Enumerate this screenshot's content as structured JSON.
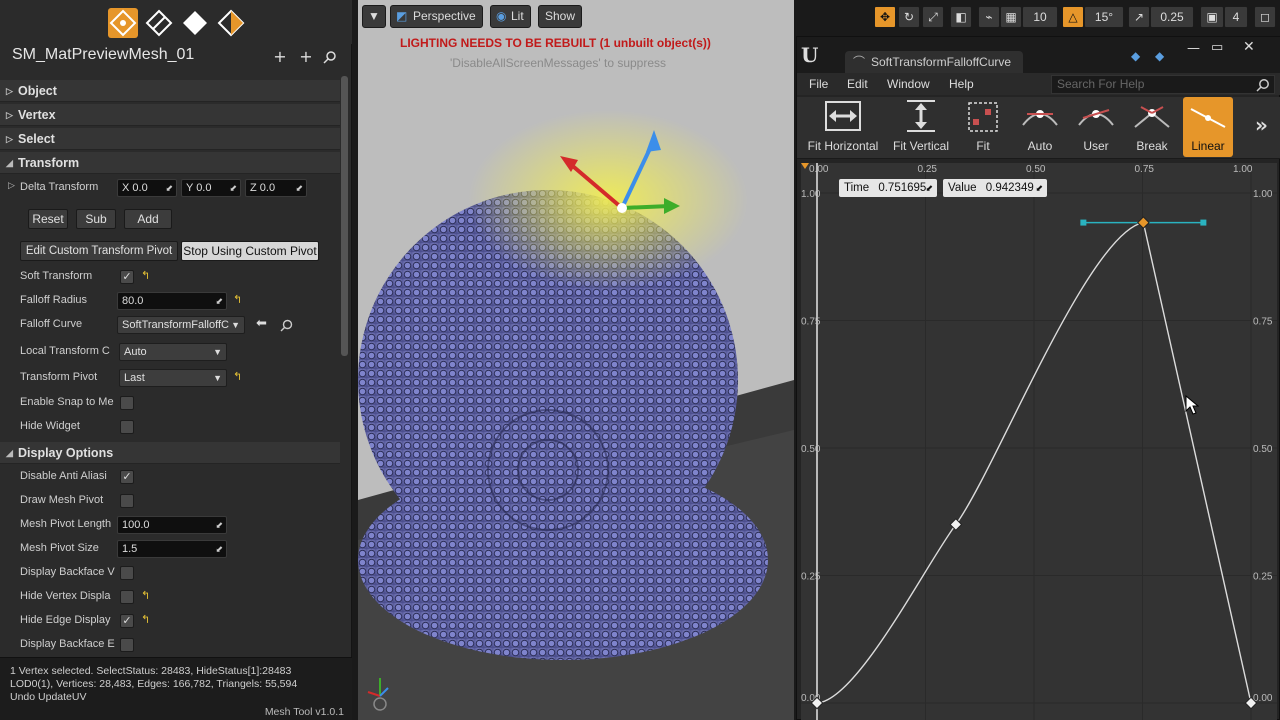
{
  "left_panel": {
    "mesh_name": "SM_MatPreviewMesh_01",
    "categories": {
      "object": "Object",
      "vertex": "Vertex",
      "select": "Select",
      "transform": "Transform",
      "display_options": "Display Options"
    },
    "delta_transform": {
      "label": "Delta Transform",
      "x": "X  0.0",
      "y": "Y  0.0",
      "z": "Z  0.0"
    },
    "buttons": {
      "reset": "Reset",
      "sub": "Sub",
      "add": "Add",
      "edit_pivot": "Edit Custom Transform Pivot",
      "stop_pivot": "Stop Using Custom Pivot"
    },
    "transform_rows": {
      "soft_transform": "Soft Transform",
      "soft_transform_checked": true,
      "falloff_radius": "Falloff Radius",
      "falloff_radius_value": "80.0",
      "falloff_curve": "Falloff Curve",
      "falloff_curve_value": "SoftTransformFalloffC",
      "local_transform": "Local Transform C",
      "local_transform_value": "Auto",
      "transform_pivot": "Transform Pivot",
      "transform_pivot_value": "Last",
      "enable_snap": "Enable Snap to Me",
      "hide_widget": "Hide Widget"
    },
    "display_rows": {
      "disable_aa": "Disable Anti Aliasi",
      "draw_mesh_pivot": "Draw Mesh Pivot",
      "mesh_pivot_length": "Mesh Pivot Length",
      "mesh_pivot_length_value": "100.0",
      "mesh_pivot_size": "Mesh Pivot Size",
      "mesh_pivot_size_value": "1.5",
      "display_backface": "Display Backface V",
      "hide_vertex": "Hide Vertex Displa",
      "hide_edge": "Hide Edge Display",
      "display_backface_e": "Display Backface E"
    },
    "status": {
      "line1": "1 Vertex selected. SelectStatus: 28483, HideStatus[1]:28483",
      "line2": "LOD0(1), Vertices: 28,483, Edges: 166,782, Triangels: 55,594",
      "line3": "Undo UpdateUV",
      "version": "Mesh Tool v1.0.1"
    }
  },
  "viewport": {
    "perspective": "Perspective",
    "lit": "Lit",
    "show": "Show",
    "warning": "LIGHTING NEEDS TO BE REBUILT (1 unbuilt object(s))",
    "warning_hint": "'DisableAllScreenMessages' to suppress"
  },
  "viewport_tools": {
    "grid_snap": "10",
    "rot_snap": "15°",
    "scale_snap": "0.25",
    "camera_speed": "4"
  },
  "curve_editor": {
    "tab": "SoftTransformFalloffCurve",
    "menu": [
      "File",
      "Edit",
      "Window",
      "Help"
    ],
    "search_placeholder": "Search For Help",
    "tools": {
      "fit_h": "Fit Horizontal",
      "fit_v": "Fit Vertical",
      "fit": "Fit",
      "auto": "Auto",
      "user": "User",
      "break": "Break",
      "linear": "Linear"
    },
    "time_label": "Time",
    "time_value": "0.751695",
    "value_label": "Value",
    "value_value": "0.942349"
  },
  "chart_data": {
    "type": "line",
    "title": "",
    "xlabel": "",
    "ylabel": "",
    "xlim": [
      0.0,
      1.0
    ],
    "ylim": [
      0.0,
      1.0
    ],
    "x_ticks": [
      "0.00",
      "0.25",
      "0.50",
      "0.75",
      "1.00"
    ],
    "y_ticks": [
      "0.00",
      "0.25",
      "0.50",
      "0.75",
      "1.00"
    ],
    "grid": true,
    "keys": [
      {
        "x": 0.0,
        "y": 0.0
      },
      {
        "x": 0.32,
        "y": 0.35
      },
      {
        "x": 0.752,
        "y": 0.942
      },
      {
        "x": 1.0,
        "y": 0.0
      }
    ],
    "selected_key": 2
  },
  "colors": {
    "accent": "#e6962a",
    "warning": "#c11a1a",
    "curve": "#dcdcdc",
    "tangent": "#2ab3c0",
    "sphere": "#7b7fc6",
    "sphere_selected": "#e6e14a"
  }
}
